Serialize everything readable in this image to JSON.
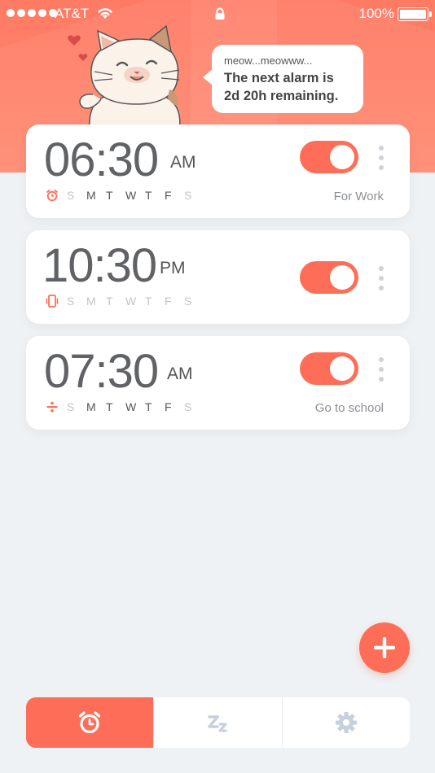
{
  "status_bar": {
    "carrier": "AT&T",
    "battery_percent": "100%"
  },
  "header": {
    "bubble_small": "meow...meowww...",
    "bubble_line1": "The next alarm is",
    "bubble_line2": "2d 20h remaining."
  },
  "alarms": [
    {
      "time": "06:30",
      "ampm": "AM",
      "icon": "alarm-clock-icon",
      "days": [
        "S",
        "M",
        "T",
        "W",
        "T",
        "F",
        "S"
      ],
      "days_active": [
        false,
        true,
        true,
        true,
        true,
        true,
        false
      ],
      "enabled": true,
      "label": "For Work"
    },
    {
      "time": "10:30",
      "ampm": "PM",
      "icon": "phone-shake-icon",
      "days": [
        "S",
        "M",
        "T",
        "W",
        "T",
        "F",
        "S"
      ],
      "days_active": [
        false,
        false,
        false,
        false,
        false,
        false,
        false
      ],
      "enabled": true,
      "label": ""
    },
    {
      "time": "07:30",
      "ampm": "AM",
      "icon": "math-divide-icon",
      "days": [
        "S",
        "M",
        "T",
        "W",
        "T",
        "F",
        "S"
      ],
      "days_active": [
        false,
        true,
        true,
        true,
        true,
        true,
        false
      ],
      "enabled": true,
      "label": "Go to school"
    }
  ],
  "tabs": [
    {
      "name": "alarm",
      "icon": "alarm-clock-icon",
      "active": true
    },
    {
      "name": "sleep",
      "icon": "sleep-zz-icon",
      "active": false
    },
    {
      "name": "settings",
      "icon": "gear-icon",
      "active": false
    }
  ],
  "colors": {
    "accent": "#fe6d57",
    "background": "#eef2f5",
    "card": "#ffffff",
    "text": "#606266"
  }
}
